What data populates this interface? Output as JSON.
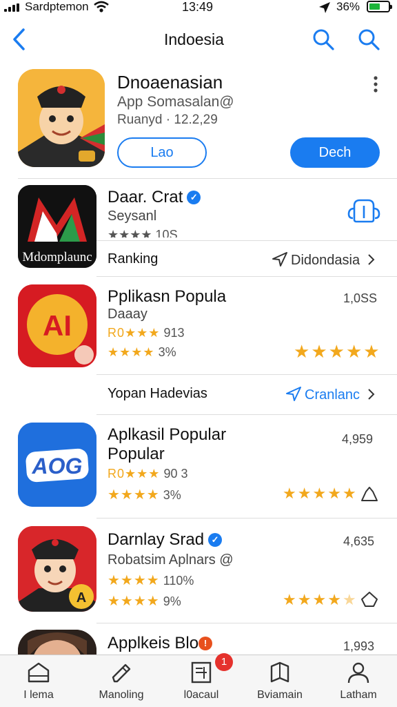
{
  "status_bar": {
    "carrier": "Sardptemon",
    "time": "13:49",
    "battery": "36%"
  },
  "nav": {
    "title": "Indoesia",
    "icons": [
      "back-chevron-icon",
      "search-icon",
      "search-icon"
    ]
  },
  "featured_app": {
    "title": "Dnoaenasian",
    "subtitle": "App Somasalan@",
    "meta": "Ruanyd · 12.2,29",
    "outline_button": "Lao",
    "solid_button": "Dech"
  },
  "app_row_1": {
    "title": "Daar. Crat",
    "subtitle": "Seysanl",
    "stars_text": "★★★★ 10S",
    "icon_caption": "Mdomplaunc"
  },
  "ranking_bar": {
    "label": "Ranking",
    "link": "Didondasia"
  },
  "app_row_2": {
    "title": "Pplikasn Popula",
    "subtitle": "Daaay",
    "line1": "913",
    "line1_prefix": "R0★★★",
    "line2": "3%",
    "right_value": "1,0SS",
    "rating": 5
  },
  "section_bar": {
    "label": "Yopan Hadevias",
    "link": "Cranlanc"
  },
  "app_row_3": {
    "title": "Aplkasil Popular",
    "title2": "Popular",
    "line1_prefix": "R0★★★",
    "line1": "90 3",
    "line2": "3%",
    "right_value": "4,959",
    "rating": 5
  },
  "app_row_4": {
    "title": "Darnlay Srad",
    "subtitle": "Robatsim Aplnars @",
    "line1": "110%",
    "line2": "9%",
    "right_value": "4,635",
    "rating": 4
  },
  "app_row_5": {
    "title": "Applkeis Blo",
    "right_value": "1,993"
  },
  "tab_bar": {
    "tabs": [
      {
        "label": "I lema",
        "icon": "home-icon"
      },
      {
        "label": "Manoling",
        "icon": "pencil-icon"
      },
      {
        "label": "l0acaul",
        "icon": "news-icon"
      },
      {
        "label": "Bviamain",
        "icon": "book-icon"
      },
      {
        "label": "Latham",
        "icon": "person-icon"
      }
    ],
    "notification_count": "1"
  },
  "colors": {
    "accent": "#1a7cf0",
    "star": "#f2a81d",
    "badge": "#e5322d"
  }
}
